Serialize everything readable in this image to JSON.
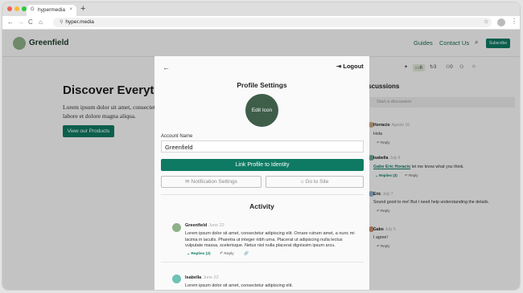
{
  "browser": {
    "tab_title": "hypermedia",
    "tab_close": "×",
    "new_tab": "+",
    "url": "hyper.media",
    "back": "←",
    "forward": "→",
    "reload": "C",
    "home": "⌂",
    "star": "☆",
    "menu": "⋮"
  },
  "site": {
    "brand": "Greenfield",
    "nav": [
      "Guides",
      "Contact Us"
    ],
    "subscribe": "Subscribe",
    "hero_title": "Discover Everythin",
    "hero_text": "Lorem ipsum dolor sit amet, consectet labore et dolore magna aliqua.",
    "hero_button": "View our Products"
  },
  "modal": {
    "back": "←",
    "logout": "Logout",
    "title": "Profile Settings",
    "avatar_label": "Edit Icon",
    "account_label": "Account Name",
    "account_value": "Greenfield",
    "link_button": "Link Profile to Identity",
    "notification_button": "Notification Settings",
    "goto_button": "Go to Site",
    "activity_title": "Activity",
    "comments": [
      {
        "name": "Greenfield",
        "date": "June 22",
        "body": "Lorem ipsum dolor sit amet, consectetur adipiscing elit. Ornare rutrum amet, a nunc mi lacinia in iaculis. Pharetra ut integer nibh urna. Placerat ut adipiscing nulla lectus vulputate massa, scelerisque. Netus nisl nulla placerat dignissim ipsum arcu.",
        "replies": "Replies (2)",
        "reply": "Reply"
      },
      {
        "name": "Isabella",
        "date": "June 22",
        "body": "Lorem ipsum dolor sit amet, consectetur adipiscing elit."
      }
    ]
  },
  "right_panel": {
    "icons": [
      {
        "icon": "sparkle-icon",
        "label": ""
      },
      {
        "icon": "comment-icon",
        "label": "6"
      },
      {
        "icon": "refresh-icon",
        "label": "3"
      },
      {
        "icon": "people-icon",
        "label": "0"
      },
      {
        "icon": "people-icon",
        "label": ""
      },
      {
        "icon": "folder-icon",
        "label": ""
      }
    ],
    "title": "iscussions",
    "placeholder": "Start a discussion",
    "discussions": [
      {
        "name": "Horracio",
        "date": "Agosto 16",
        "body": "Hola",
        "reply": "Reply"
      },
      {
        "name": "Isabella",
        "date": "July 9",
        "mention": "Gabo Eric Horacio",
        "body": " let me know what you think.",
        "replies": "Replies (3)",
        "reply": "Reply"
      },
      {
        "name": "Eric",
        "date": "July 7",
        "body": "Sound good to me! But I need help understanding the details.",
        "reply": "Reply"
      },
      {
        "name": "Gabo",
        "date": "July 5",
        "body": "I agree!",
        "reply": "Reply"
      }
    ]
  },
  "colors": {
    "accent": "#0f7a63",
    "brand_dark": "#1b3a2a",
    "avatar_bg": "#3e5e4a"
  }
}
